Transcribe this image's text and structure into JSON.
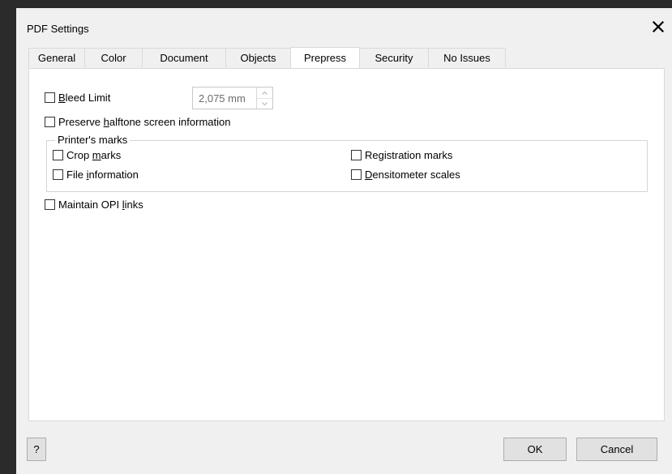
{
  "window": {
    "title": "PDF Settings",
    "close_icon": "close-icon"
  },
  "tabs": [
    {
      "label": "General",
      "active": false
    },
    {
      "label": "Color",
      "active": false
    },
    {
      "label": "Document",
      "active": false
    },
    {
      "label": "Objects",
      "active": false
    },
    {
      "label": "Prepress",
      "active": true
    },
    {
      "label": "Security",
      "active": false
    },
    {
      "label": "No Issues",
      "active": false
    }
  ],
  "prepress": {
    "bleed_limit": {
      "pre": "",
      "mnemonic": "B",
      "post": "leed Limit",
      "checked": false,
      "value": "2,075 mm"
    },
    "preserve_halftone": {
      "pre": "Preserve ",
      "mnemonic": "h",
      "post": "alftone screen information",
      "checked": false
    },
    "printers_marks": {
      "label": "Printer's marks",
      "crop_marks": {
        "pre": "Crop ",
        "mnemonic": "m",
        "post": "arks",
        "checked": false
      },
      "file_information": {
        "pre": "File ",
        "mnemonic": "i",
        "post": "nformation",
        "checked": false
      },
      "registration_marks": {
        "pre": "Re",
        "mnemonic": "g",
        "post": "istration marks",
        "checked": false
      },
      "densitometer_scales": {
        "pre": "",
        "mnemonic": "D",
        "post": "ensitometer scales",
        "checked": false
      }
    },
    "maintain_opi": {
      "pre": "Maintain OPI ",
      "mnemonic": "l",
      "post": "inks",
      "checked": false
    }
  },
  "footer": {
    "help_label": "?",
    "ok_label": "OK",
    "cancel_label": "Cancel"
  }
}
